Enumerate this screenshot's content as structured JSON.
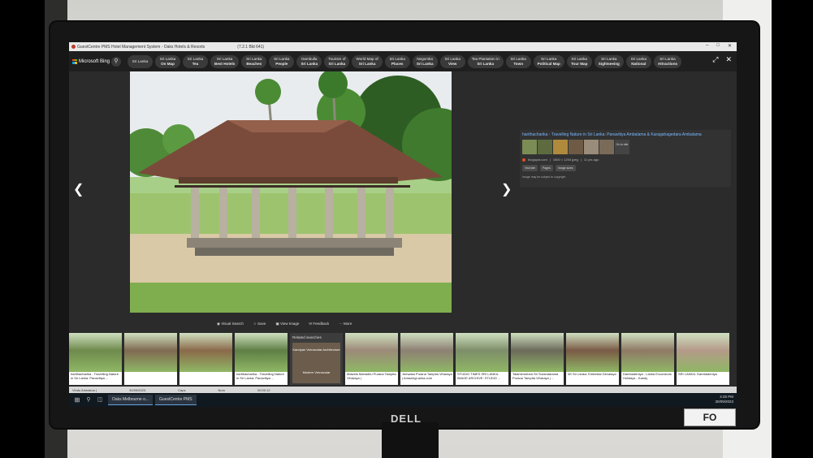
{
  "window": {
    "title": "GuestCentre PMS Hotel Management System - Oaks Hotels & Resorts",
    "build": "(7.2.1 Bld 641)"
  },
  "bing": {
    "logo_text": "Microsoft Bing",
    "chips": [
      {
        "line1": "Sri Lanka",
        "line2": ""
      },
      {
        "line1": "Sri Lanka",
        "line2": "On Map"
      },
      {
        "line1": "Sri Lanka",
        "line2": "Tea"
      },
      {
        "line1": "Sri Lanka",
        "line2": "Best Hotels"
      },
      {
        "line1": "Sri Lanka",
        "line2": "Beaches"
      },
      {
        "line1": "Sri Lanka",
        "line2": "People"
      },
      {
        "line1": "Dambulla",
        "line2": "Sri Lanka"
      },
      {
        "line1": "Tourism of",
        "line2": "Sri Lanka"
      },
      {
        "line1": "World Map of",
        "line2": "Sri Lanka"
      },
      {
        "line1": "Sri Lanka",
        "line2": "Places"
      },
      {
        "line1": "Negombo",
        "line2": "Sri Lanka"
      },
      {
        "line1": "Sri Lanka",
        "line2": "View"
      },
      {
        "line1": "Tea Plantation in",
        "line2": "Sri Lanka"
      },
      {
        "line1": "Sri Lanka",
        "line2": "Town"
      },
      {
        "line1": "Sri Lanka",
        "line2": "Political Map"
      },
      {
        "line1": "Sri Lanka",
        "line2": "Tour Map"
      },
      {
        "line1": "Sri Lanka",
        "line2": "Sightseeing"
      },
      {
        "line1": "Sri Lanka",
        "line2": "National"
      },
      {
        "line1": "Sri Lanka",
        "line2": "Attractions"
      }
    ],
    "info_card": {
      "title": "harithacharika - Travelling Nature in Sri Lanka: Panavitiya Ambalama & Karagahagedara Ambalama",
      "go_to_site": "Go to site",
      "source": "blogspot.com",
      "dimensions": "1600 × 1204 jpeg",
      "age": "11 yrs ago",
      "buttons": [
        "Visit site",
        "Pages",
        "Image sizes"
      ],
      "copyright": "Image may be subject to copyright"
    },
    "actions": [
      "Visual Search",
      "Save",
      "View Image",
      "Feedback",
      "More"
    ],
    "strip": [
      {
        "caption": "harithacharika - Travelling Nature in Sri Lanka: Panavitiya ..."
      },
      {
        "caption": ""
      },
      {
        "caption": ""
      },
      {
        "caption": "harithacharika - Travelling Nature in Sri Lanka: Panavitiya ..."
      },
      {
        "related": true,
        "heading": "Related searches",
        "cap1": "Kandyan Vernacular Architecture",
        "cap2": "Modern Vernacular"
      },
      {
        "caption": "Mawela Mahadhu Purana Tampita Viharaya |"
      },
      {
        "caption": "Jeewaka Purana Tampita Viharaya | AmazingLanka.com"
      },
      {
        "caption": "STUDIO TIMES SRI LANKA IMAGE ARCHIVE: STUDIO ..."
      },
      {
        "caption": "Talaminnehea Sri Surandarama Purana Tampita Viharaya | ..."
      },
      {
        "caption": "W/ Sri Lanka: Embekke Devalaya"
      },
      {
        "caption": "Dambadeniya - Lanka Excursions Holidays - Kandy"
      },
      {
        "caption": "SRI LANKA: Dambadeniya"
      }
    ]
  },
  "statusbar": {
    "user": "Vindu Amnakus (",
    "date": "30/09/2023",
    "caps": "Caps",
    "num": "Num",
    "time": "00:00:12"
  },
  "taskbar": {
    "items": [
      "Oaks Melbourne o...",
      "GuestCentre PMS"
    ],
    "clock": "4:25 PM",
    "date": "30/09/2023"
  },
  "hardware": {
    "brand": "DELL",
    "tag": "FO"
  }
}
